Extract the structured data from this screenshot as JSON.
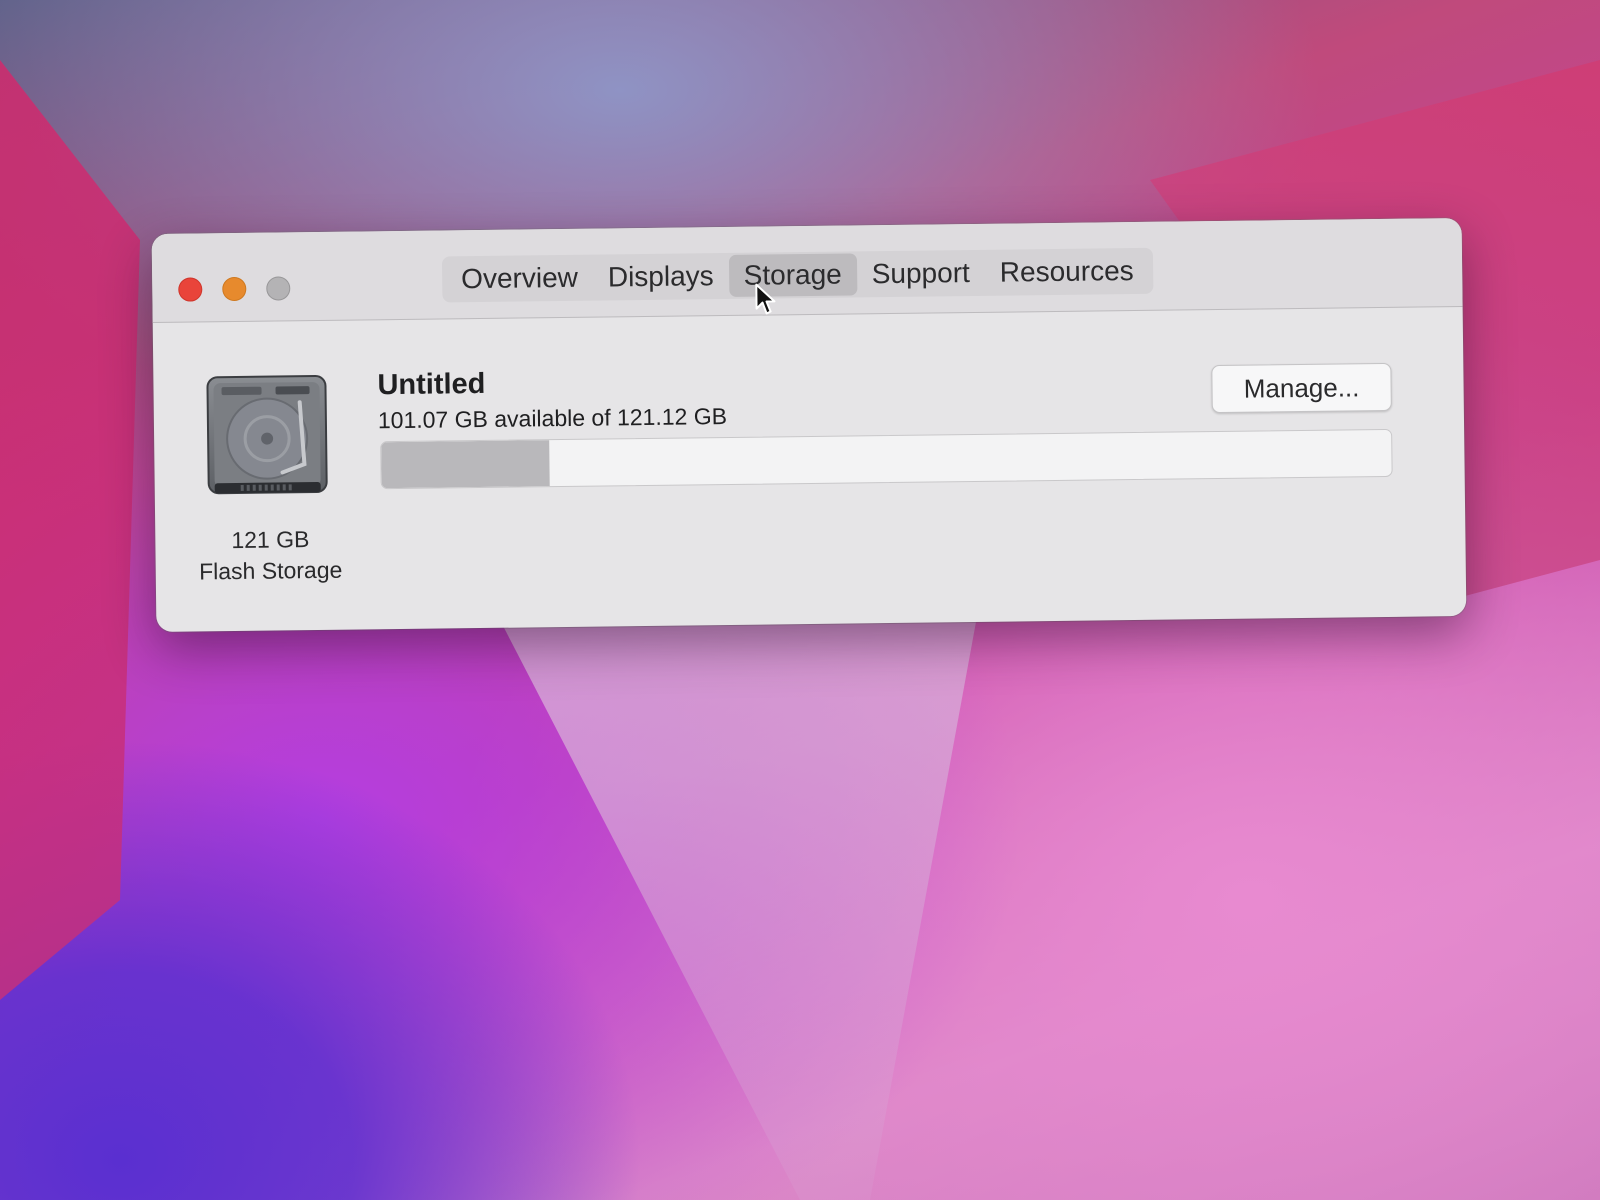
{
  "window": {
    "tabs": [
      {
        "label": "Overview"
      },
      {
        "label": "Displays"
      },
      {
        "label": "Storage"
      },
      {
        "label": "Support"
      },
      {
        "label": "Resources"
      }
    ],
    "active_tab": "Storage"
  },
  "storage": {
    "drive_capacity": "121 GB",
    "drive_type": "Flash Storage",
    "volume_name": "Untitled",
    "available_text": "101.07 GB available of 121.12 GB",
    "used_fraction": 0.166,
    "manage_label": "Manage..."
  },
  "colors": {
    "close": "#e9443a",
    "minimize": "#e78a2d",
    "zoom": "#b4b3b5"
  },
  "icons": {
    "drive": "hard-drive-icon",
    "cursor": "mouse-pointer-icon"
  }
}
